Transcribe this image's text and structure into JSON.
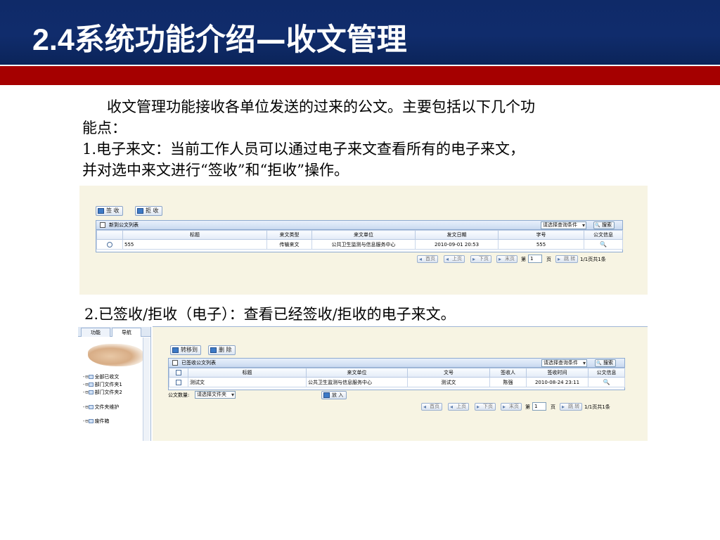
{
  "slide": {
    "title_num": "2.4",
    "title_text": "系统功能介绍—收文管理",
    "para1_line1": "收文管理功能接收各单位发送的过来的公文。主要包括以下几个功",
    "para1_line2": "能点：",
    "item1_line1": "1.电子来文：当前工作人员可以通过电子来文查看所有的电子来文，",
    "item1_line2": "并对选中来文进行“签收”和“拒收”操作。",
    "item2": "2.已签收/拒收（电子）：查看已经签收/拒收的电子来文。"
  },
  "shot1": {
    "toolbar": {
      "sign_label": "签 收",
      "reject_label": "拒 收"
    },
    "grid_title": "新到公文列表",
    "search_select": "请选择查询条件",
    "search_button": "搜索",
    "columns": [
      "标题",
      "来文类型",
      "来文单位",
      "发文日期",
      "字号",
      "公文信息"
    ],
    "row": {
      "title": "555",
      "type": "传输来文",
      "unit": "公共卫生监测与信息服务中心",
      "date": "2010-09-01 20:53",
      "number": "555"
    },
    "pager": {
      "first": "首页",
      "prev": "上页",
      "next": "下页",
      "last": "末页",
      "page_prefix": "第",
      "page_value": "1",
      "page_suffix": "页",
      "jump": "跳 转",
      "summary": "1/1页共1条"
    }
  },
  "shot2": {
    "nav": {
      "tab_function": "功能",
      "tab_navigation": "导航",
      "tree": [
        "全部已收文",
        "部门文件夹1",
        "部门文件夹2",
        "文件夹维护",
        "废件箱"
      ]
    },
    "toolbar": {
      "transfer_label": "转移到",
      "delete_label": "删 除"
    },
    "grid_title": "已签收公文列表",
    "search_select": "请选择查询条件",
    "search_button": "搜索",
    "columns": [
      "标题",
      "来文单位",
      "文号",
      "签收人",
      "签收时间",
      "公文信息"
    ],
    "row": {
      "title": "测试文",
      "unit": "公共卫生监测与信息服务中心",
      "number": "测试文",
      "signer": "陈强",
      "time": "2010-08-24 23:11"
    },
    "footer": {
      "label": "公文数量:",
      "select": "请选择文件夹",
      "button": "放 入"
    },
    "pager": {
      "first": "首页",
      "prev": "上页",
      "next": "下页",
      "last": "末页",
      "page_prefix": "第",
      "page_value": "1",
      "page_suffix": "页",
      "jump": "跳 转",
      "summary": "1/1页共1条"
    }
  }
}
